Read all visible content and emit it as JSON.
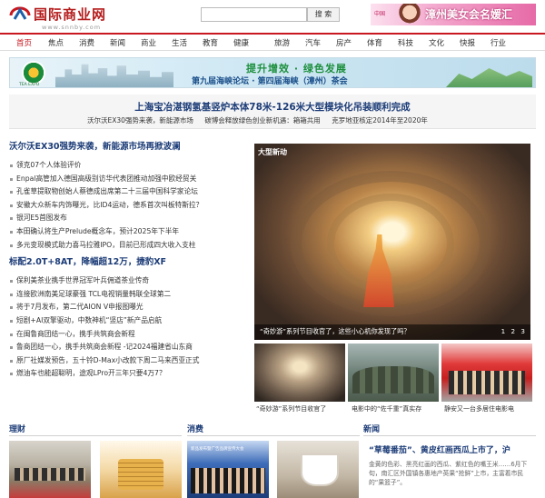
{
  "header": {
    "logo_text": "国际商业网",
    "logo_url": "www.snnby.com",
    "search_placeholder": "",
    "search_button": "搜 索",
    "ad_small": "漳州美女会名媛汇",
    "ad_big": "漳州美女会名媛汇"
  },
  "nav": [
    {
      "label": "首页",
      "active": true
    },
    {
      "label": "焦点"
    },
    {
      "label": "消费"
    },
    {
      "label": "新闻"
    },
    {
      "label": "商业"
    },
    {
      "label": "生活"
    },
    {
      "label": "教育"
    },
    {
      "label": "健康"
    },
    {
      "label": "旅游"
    },
    {
      "label": "汽车"
    },
    {
      "label": "房产"
    },
    {
      "label": "体育"
    },
    {
      "label": "科技"
    },
    {
      "label": "文化"
    },
    {
      "label": "快报"
    },
    {
      "label": "行业"
    }
  ],
  "banner": {
    "emblem_text": "TEA EXPO",
    "slogan": "提升增效 · 绿色发展",
    "subtitle": "第九届海峡论坛 · 第四届海峡（漳州）茶会"
  },
  "headline": {
    "title": "上海宝冶湛钢氢基竖炉本体78米-126米大型模块化吊装顺利完成",
    "subs": [
      "沃尔沃EX30强势来袭，新能源市场",
      "碳博会释放绿色创业新机遇：箱箱共用",
      "克罗地亚核定2014年至2020年"
    ]
  },
  "left": {
    "section1_title": "沃尔沃EX30强势来袭，新能源市场再掀波澜",
    "section1_items": [
      "领克07个人体验评价",
      "Enpal高管加入德国高级别访华代表团推动加强中欧经贸关",
      "孔雀草提取物创始人蔡德成出席第二十三届中国科学家论坛",
      "安徽大众新车内饰曝光，比ID4运动，德系首次叫板特斯拉？",
      "银河E5首图发布",
      "本田确认将生产Prelude概念车，预计2025年下半年",
      "多元变现模式助力喜马拉雅IPO，目前已形成四大收入支柱"
    ],
    "section2_title": "标配2.0T+8AT，降幅超12万，捷豹XF",
    "section2_items": [
      "保利美茶业携手世界冠军叶兵佣道茶业传奇",
      "连接欧洲南美足球豪强 TCL电视销量韩联全球第二",
      "将于7月发布，第二代AION V申报图曝光",
      "短剧+AI双擎驱动，中数神机“竖店”新产品启航",
      "在闽鲁商团结一心，携手共筑商会新程",
      "鲁商团结一心，携手共筑商会新程 -记2024福建省山东商",
      "原厂社媒发预告，五十铃D-Max小改款下周二马来西亚正式",
      "燃油车也能超聪明，途观LPro开三年只要4万7？"
    ]
  },
  "gallery": {
    "main_logo": "大型新动",
    "main_caption": "“奇妙游”系列节目收官了，这些小心机你发现了吗？",
    "dots": [
      "1",
      "2",
      "3"
    ],
    "thumbs": [
      "“奇妙游”系列节目收官了",
      "电影中的“佐千重”真实存",
      "静安又一台多居住电影电"
    ]
  },
  "bottom": {
    "sections": [
      "理财",
      "消费",
      "新闻"
    ],
    "pic3_text": "新品发布暨广告品牌宣传大会",
    "news_title": "“草莓番茄”、黄皮红画西瓜上市了，沪",
    "news_desc": "金黄的色彩、黑亮红画的西瓜、紫红色的嘴王米……6月下旬，南汇区外国镇各惠地产英果“抢鲜”上市，主富着市民的“果篮子”。"
  }
}
